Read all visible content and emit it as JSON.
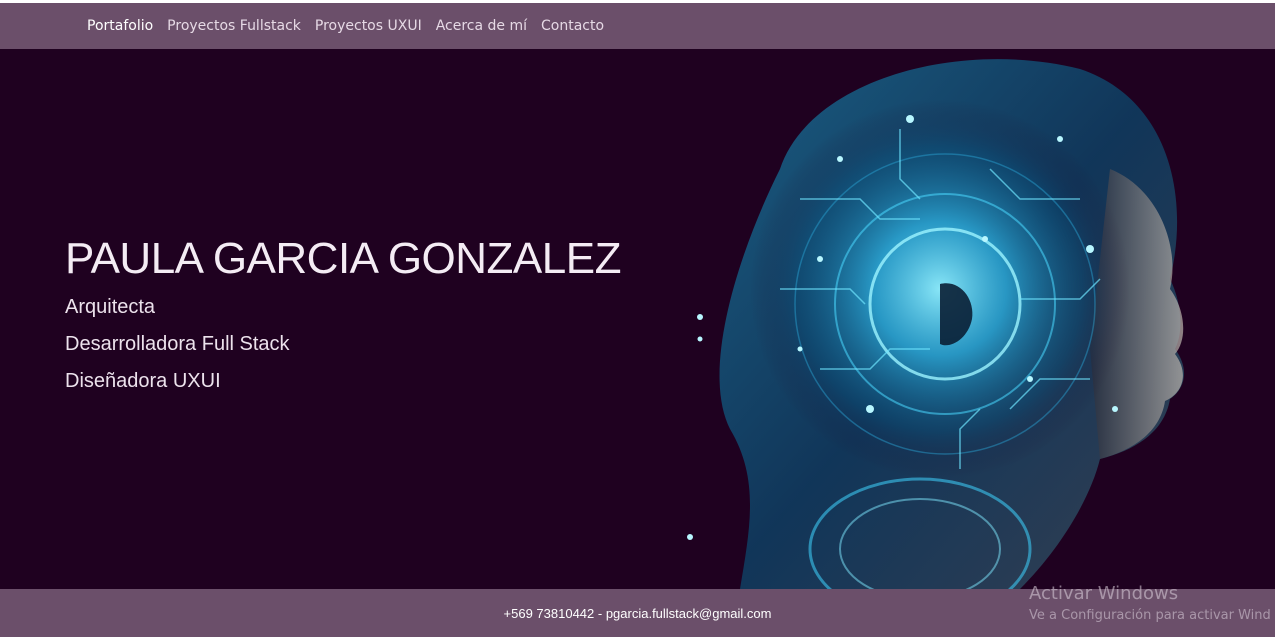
{
  "nav": {
    "brand": "Portafolio",
    "links": [
      "Proyectos Fullstack",
      "Proyectos UXUI",
      "Acerca de mí",
      "Contacto"
    ]
  },
  "hero": {
    "name": "PAULA GARCIA GONZALEZ",
    "roles": [
      "Arquitecta",
      "Desarrolladora Full Stack",
      "Diseñadora UXUI"
    ]
  },
  "footer": {
    "contact": "+569 73810442 - pgarcia.fullstack@gmail.com"
  },
  "watermark": {
    "title": "Activar Windows",
    "subtitle": "Ve a Configuración para activar Wind"
  },
  "colors": {
    "bar": "#6b4f6a",
    "hero_background": "#1f0120",
    "accent": "#3ad0ff"
  }
}
